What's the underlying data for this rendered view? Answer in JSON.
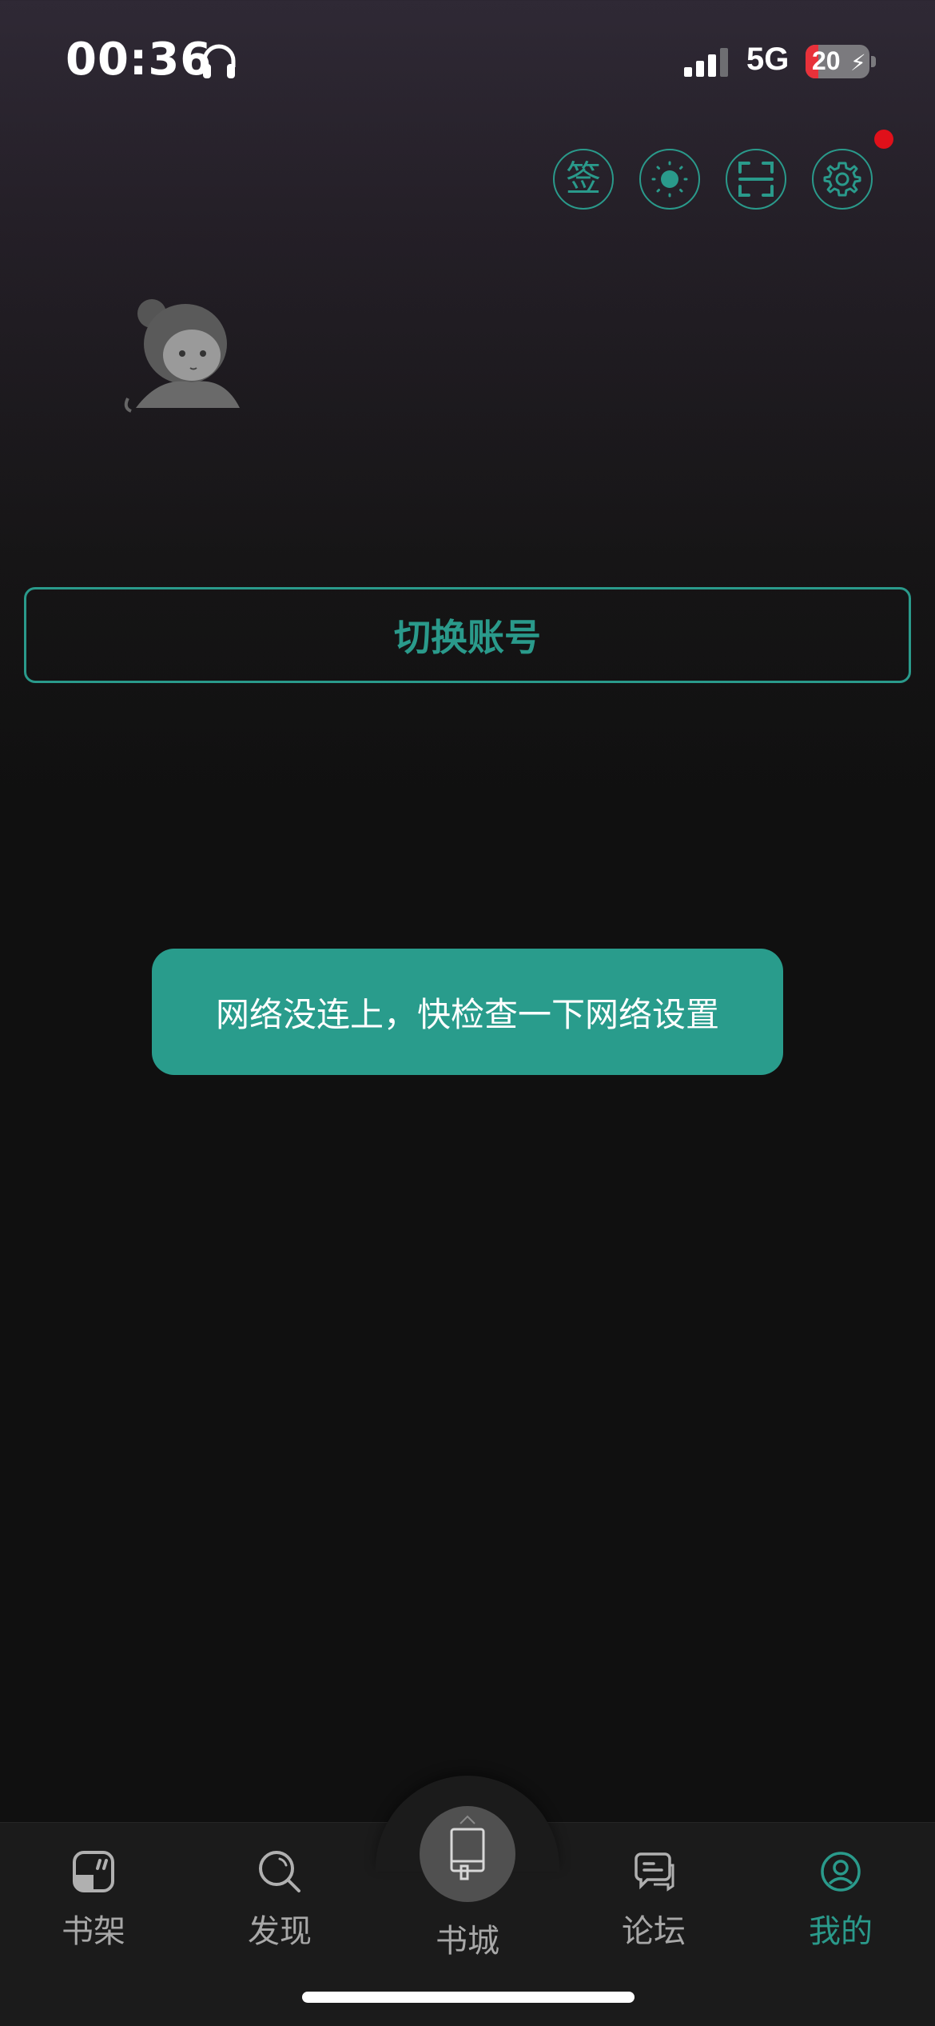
{
  "status_bar": {
    "time": "00:36",
    "network": "5G",
    "battery_level": "20"
  },
  "header": {
    "sign_label": "签",
    "notification_dot_color": "#e0101a"
  },
  "account": {
    "switch_label": "切换账号"
  },
  "toast": {
    "message": "网络没连上，快检查一下网络设置"
  },
  "tabbar": {
    "items": [
      {
        "label": "书架",
        "icon": "bookshelf-icon"
      },
      {
        "label": "发现",
        "icon": "discover-icon"
      },
      {
        "label": "书城",
        "icon": "bookstore-icon"
      },
      {
        "label": "论坛",
        "icon": "forum-icon"
      },
      {
        "label": "我的",
        "icon": "profile-icon"
      }
    ],
    "active_index": 4
  },
  "colors": {
    "accent": "#2a9a8b",
    "toast_bg": "#299c8c",
    "background": "#101010"
  }
}
